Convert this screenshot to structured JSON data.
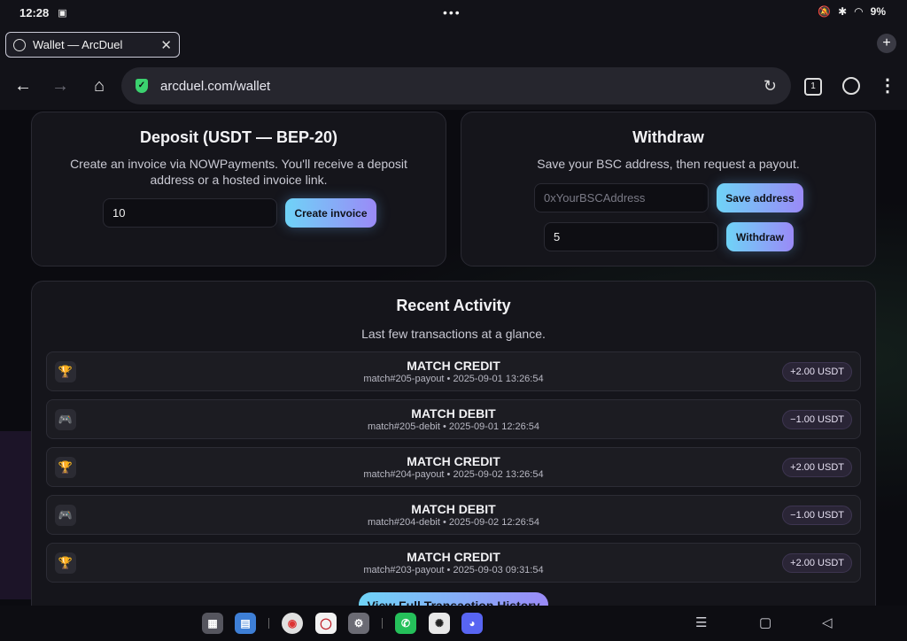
{
  "status_bar": {
    "time": "12:28",
    "battery": "9%"
  },
  "tab": {
    "title": "Wallet — ArcDuel"
  },
  "toolbar": {
    "url": "arcduel.com/wallet",
    "tab_count": "1"
  },
  "deposit": {
    "title": "Deposit (USDT — BEP-20)",
    "description": "Create an invoice via NOWPayments. You'll receive a deposit address or a hosted invoice link.",
    "amount_value": "10",
    "button_label": "Create invoice"
  },
  "withdraw": {
    "title": "Withdraw",
    "description": "Save your BSC address, then request a payout.",
    "address_placeholder": "0xYourBSCAddress",
    "save_button_label": "Save address",
    "amount_value": "5",
    "withdraw_button_label": "Withdraw"
  },
  "activity": {
    "title": "Recent Activity",
    "subtitle": "Last few transactions at a glance.",
    "rows": [
      {
        "icon": "trophy-icon",
        "type": "MATCH CREDIT",
        "meta": "match#205-payout • 2025-09-01 13:26:54",
        "amount": "+2.00 USDT"
      },
      {
        "icon": "gamepad-icon",
        "type": "MATCH DEBIT",
        "meta": "match#205-debit • 2025-09-01 12:26:54",
        "amount": "−1.00 USDT"
      },
      {
        "icon": "trophy-icon",
        "type": "MATCH CREDIT",
        "meta": "match#204-payout • 2025-09-02 13:26:54",
        "amount": "+2.00 USDT"
      },
      {
        "icon": "gamepad-icon",
        "type": "MATCH DEBIT",
        "meta": "match#204-debit • 2025-09-02 12:26:54",
        "amount": "−1.00 USDT"
      },
      {
        "icon": "trophy-icon",
        "type": "MATCH CREDIT",
        "meta": "match#203-payout • 2025-09-03 09:31:54",
        "amount": "+2.00 USDT"
      }
    ],
    "view_all_label": "View Full Transaction History"
  }
}
